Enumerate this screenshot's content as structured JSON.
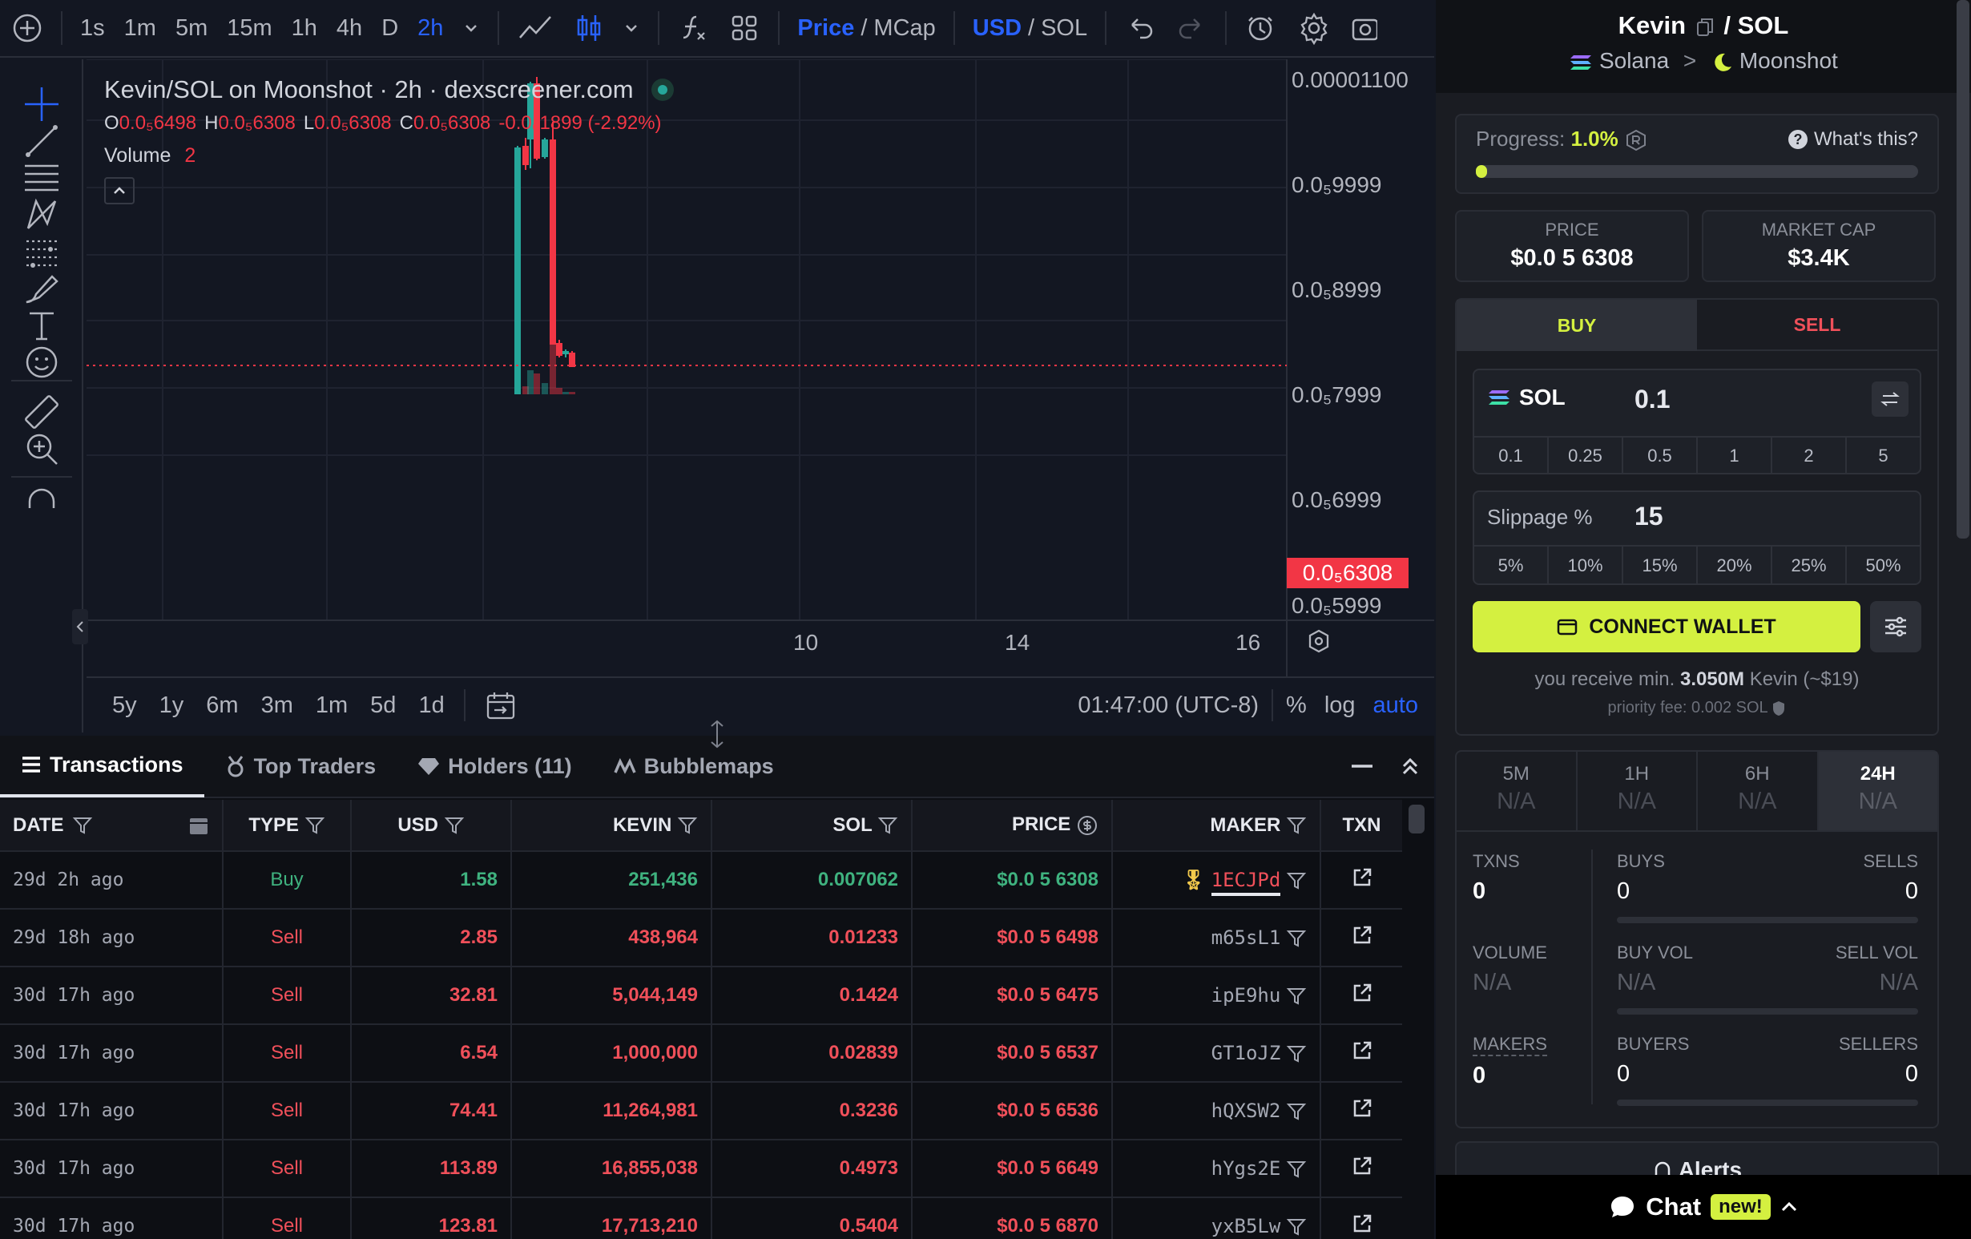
{
  "toolbar": {
    "intervals": [
      "1s",
      "1m",
      "5m",
      "15m",
      "1h",
      "4h",
      "D",
      "2h"
    ],
    "active_interval": "2h",
    "price_label": "Price",
    "mcap_label": "MCap",
    "usd_label": "USD",
    "sol_label": "SOL",
    "slash": "/"
  },
  "chart": {
    "title": "Kevin/SOL on Moonshot · 2h · dexscreener.com",
    "ohlc": {
      "o_key": "O",
      "o": "0.0₅6498",
      "h_key": "H",
      "h": "0.0₅6308",
      "l_key": "L",
      "l": "0.0₅6308",
      "c_key": "C",
      "c": "0.0₅6308",
      "change": "-0.0₆1899 (-2.92%)"
    },
    "volume_label": "Volume",
    "volume_value": "2",
    "price_axis": [
      "0.00001100",
      "0.0₅9999",
      "0.0₅8999",
      "0.0₅7999",
      "0.0₅6999",
      "0.0₅5999"
    ],
    "current_price": "0.0₅6308",
    "time_axis": [
      "10",
      "14",
      "16"
    ],
    "ranges": [
      "5y",
      "1y",
      "6m",
      "3m",
      "1m",
      "5d",
      "1d"
    ],
    "clock": "01:47:00 (UTC-8)",
    "pct": "%",
    "log": "log",
    "auto": "auto"
  },
  "tabs": {
    "transactions": "Transactions",
    "top_traders": "Top Traders",
    "holders": "Holders (11)",
    "bubblemaps": "Bubblemaps"
  },
  "table": {
    "headers": {
      "date": "DATE",
      "type": "TYPE",
      "usd": "USD",
      "kevin": "KEVIN",
      "sol": "SOL",
      "price": "PRICE",
      "maker": "MAKER",
      "txn": "TXN"
    },
    "rows": [
      {
        "date": "29d 2h ago",
        "type": "Buy",
        "usd": "1.58",
        "kevin": "251,436",
        "sol": "0.007062",
        "price": "$0.0 5 6308",
        "maker": "1ECJPd"
      },
      {
        "date": "29d 18h ago",
        "type": "Sell",
        "usd": "2.85",
        "kevin": "438,964",
        "sol": "0.01233",
        "price": "$0.0 5 6498",
        "maker": "m65sL1"
      },
      {
        "date": "30d 17h ago",
        "type": "Sell",
        "usd": "32.81",
        "kevin": "5,044,149",
        "sol": "0.1424",
        "price": "$0.0 5 6475",
        "maker": "ipE9hu"
      },
      {
        "date": "30d 17h ago",
        "type": "Sell",
        "usd": "6.54",
        "kevin": "1,000,000",
        "sol": "0.02839",
        "price": "$0.0 5 6537",
        "maker": "GT1oJZ"
      },
      {
        "date": "30d 17h ago",
        "type": "Sell",
        "usd": "74.41",
        "kevin": "11,264,981",
        "sol": "0.3236",
        "price": "$0.0 5 6536",
        "maker": "hQXSW2"
      },
      {
        "date": "30d 17h ago",
        "type": "Sell",
        "usd": "113.89",
        "kevin": "16,855,038",
        "sol": "0.4973",
        "price": "$0.0 5 6649",
        "maker": "hYgs2E"
      },
      {
        "date": "30d 17h ago",
        "type": "Sell",
        "usd": "123.81",
        "kevin": "17,713,210",
        "sol": "0.5404",
        "price": "$0.0 5 6870",
        "maker": "yxB5Lw"
      }
    ]
  },
  "right": {
    "pair_base": "Kevin",
    "pair_sep": "/",
    "pair_quote": "SOL",
    "chain": "Solana",
    "chevron": ">",
    "dex": "Moonshot",
    "progress_label": "Progress:",
    "progress_value": "1.0%",
    "progress_fraction": 0.01,
    "whats_this": "What's this?",
    "price_label": "PRICE",
    "price_value": "$0.0 5 6308",
    "mcap_label": "MARKET CAP",
    "mcap_value": "$3.4K",
    "buy_tab": "BUY",
    "sell_tab": "SELL",
    "token": "SOL",
    "amount": "0.1",
    "amount_presets": [
      "0.1",
      "0.25",
      "0.5",
      "1",
      "2",
      "5"
    ],
    "slippage_label": "Slippage %",
    "slippage_value": "15",
    "slippage_presets": [
      "5%",
      "10%",
      "15%",
      "20%",
      "25%",
      "50%"
    ],
    "connect_wallet": "CONNECT WALLET",
    "receive_prefix": "you receive min.",
    "receive_amount": "3.050M",
    "receive_suffix": "Kevin (~$19)",
    "priority_fee": "priority fee: 0.002 SOL",
    "periods": [
      {
        "label": "5M",
        "value": "N/A"
      },
      {
        "label": "1H",
        "value": "N/A"
      },
      {
        "label": "6H",
        "value": "N/A"
      },
      {
        "label": "24H",
        "value": "N/A"
      }
    ],
    "txns_label": "TXNS",
    "txns_value": "0",
    "buys_label": "BUYS",
    "buys_value": "0",
    "sells_label": "SELLS",
    "sells_value": "0",
    "volume_label": "VOLUME",
    "volume_value": "N/A",
    "buyvol_label": "BUY VOL",
    "buyvol_value": "N/A",
    "sellvol_label": "SELL VOL",
    "sellvol_value": "N/A",
    "makers_label": "MAKERS",
    "makers_value": "0",
    "buyers_label": "BUYERS",
    "buyers_value": "0",
    "sellers_label": "SELLERS",
    "sellers_value": "0",
    "alerts": "Alerts",
    "chat": "Chat",
    "new_badge": "new!"
  },
  "colors": {
    "up": "#26a69a",
    "down": "#f23645",
    "accent": "#2962ff",
    "lime": "#d4f040"
  }
}
